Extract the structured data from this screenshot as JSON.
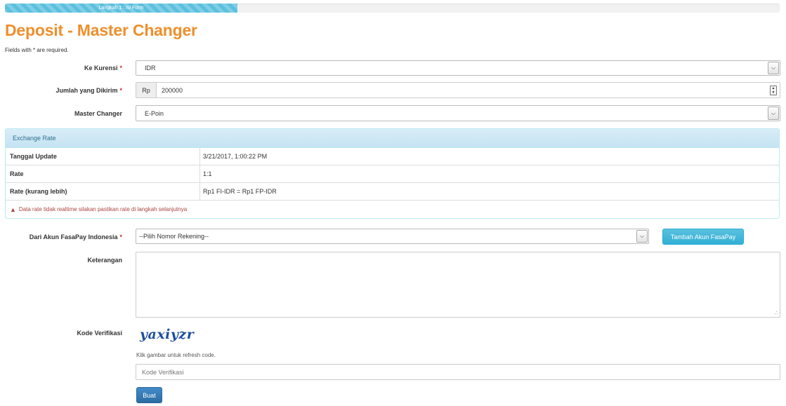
{
  "progress": {
    "label": "Langkah 1 : Isi Form",
    "percent": 30,
    "color": "#5bc0de"
  },
  "page": {
    "title": "Deposit - Master Changer",
    "required_note": "Fields with * are required."
  },
  "form": {
    "currency": {
      "label": "Ke Kurensi",
      "required": "*",
      "value": "IDR"
    },
    "amount": {
      "label": "Jumlah yang Dikirim",
      "required": "*",
      "prefix": "Rp",
      "value": "200000"
    },
    "changer": {
      "label": "Master Changer",
      "value": "E-Poin"
    },
    "account": {
      "label": "Dari Akun FasaPay Indonesia",
      "required": "*",
      "value": "--Pilih Nomor Rekening--"
    },
    "add_account_button": "Tambah Akun FasaPay",
    "notes": {
      "label": "Keterangan",
      "value": ""
    },
    "verification": {
      "label": "Kode Verifikasi",
      "captcha_text": "yaxiyzr",
      "hint": "Klik gambar untuk refresh code.",
      "placeholder": "Kode Verifikasi"
    },
    "submit_button": "Buat"
  },
  "exchange_panel": {
    "title": "Exchange Rate",
    "rows": [
      {
        "key": "Tanggal Update",
        "value": "3/21/2017, 1:00:22 PM"
      },
      {
        "key": "Rate",
        "value": "1:1"
      },
      {
        "key": "Rate (kurang lebih)",
        "value": "Rp1 FI-IDR = Rp1 FP-IDR"
      }
    ],
    "warning": "Data rate tidak realtime silakan pastikan rate di langkah selanjutnya",
    "warning_icon": "warning-triangle-icon"
  },
  "colors": {
    "title": "#ee8f2c",
    "primary": "#428bca",
    "info": "#5bc0de",
    "danger": "#a94442"
  }
}
